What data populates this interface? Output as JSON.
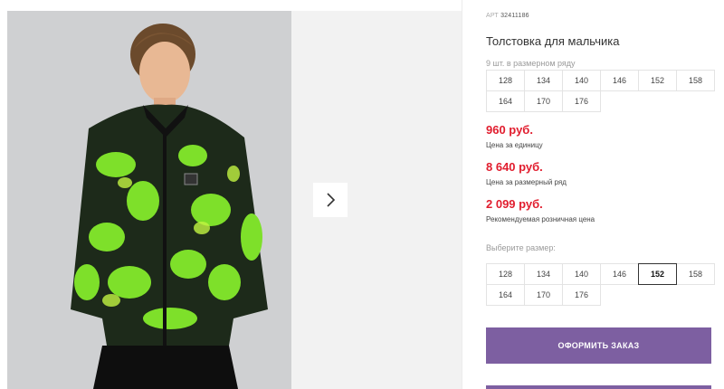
{
  "product": {
    "article_label": "АРТ",
    "article_value": "32411186",
    "title": "Толстовка для мальчика"
  },
  "size_range": {
    "note": "9 шт. в размерном ряду",
    "sizes": [
      "128",
      "134",
      "140",
      "146",
      "152",
      "158",
      "164",
      "170",
      "176"
    ]
  },
  "prices": {
    "unit_price": "960 руб.",
    "unit_label": "Цена за единицу",
    "range_price": "8 640 руб.",
    "range_label": "Цена за размерный ряд",
    "retail_price": "2 099 руб.",
    "retail_label": "Рекомендуемая розничная цена"
  },
  "size_select": {
    "label": "Выберите размер:",
    "sizes": [
      "128",
      "134",
      "140",
      "146",
      "152",
      "158",
      "164",
      "170",
      "176"
    ],
    "selected": "152"
  },
  "actions": {
    "order_label": "ОФОРМИТЬ ЗАКАЗ"
  },
  "icons": {
    "next": "chevron-right-icon"
  },
  "colors": {
    "accent": "#7d5fa1",
    "price": "#e11d2e"
  }
}
